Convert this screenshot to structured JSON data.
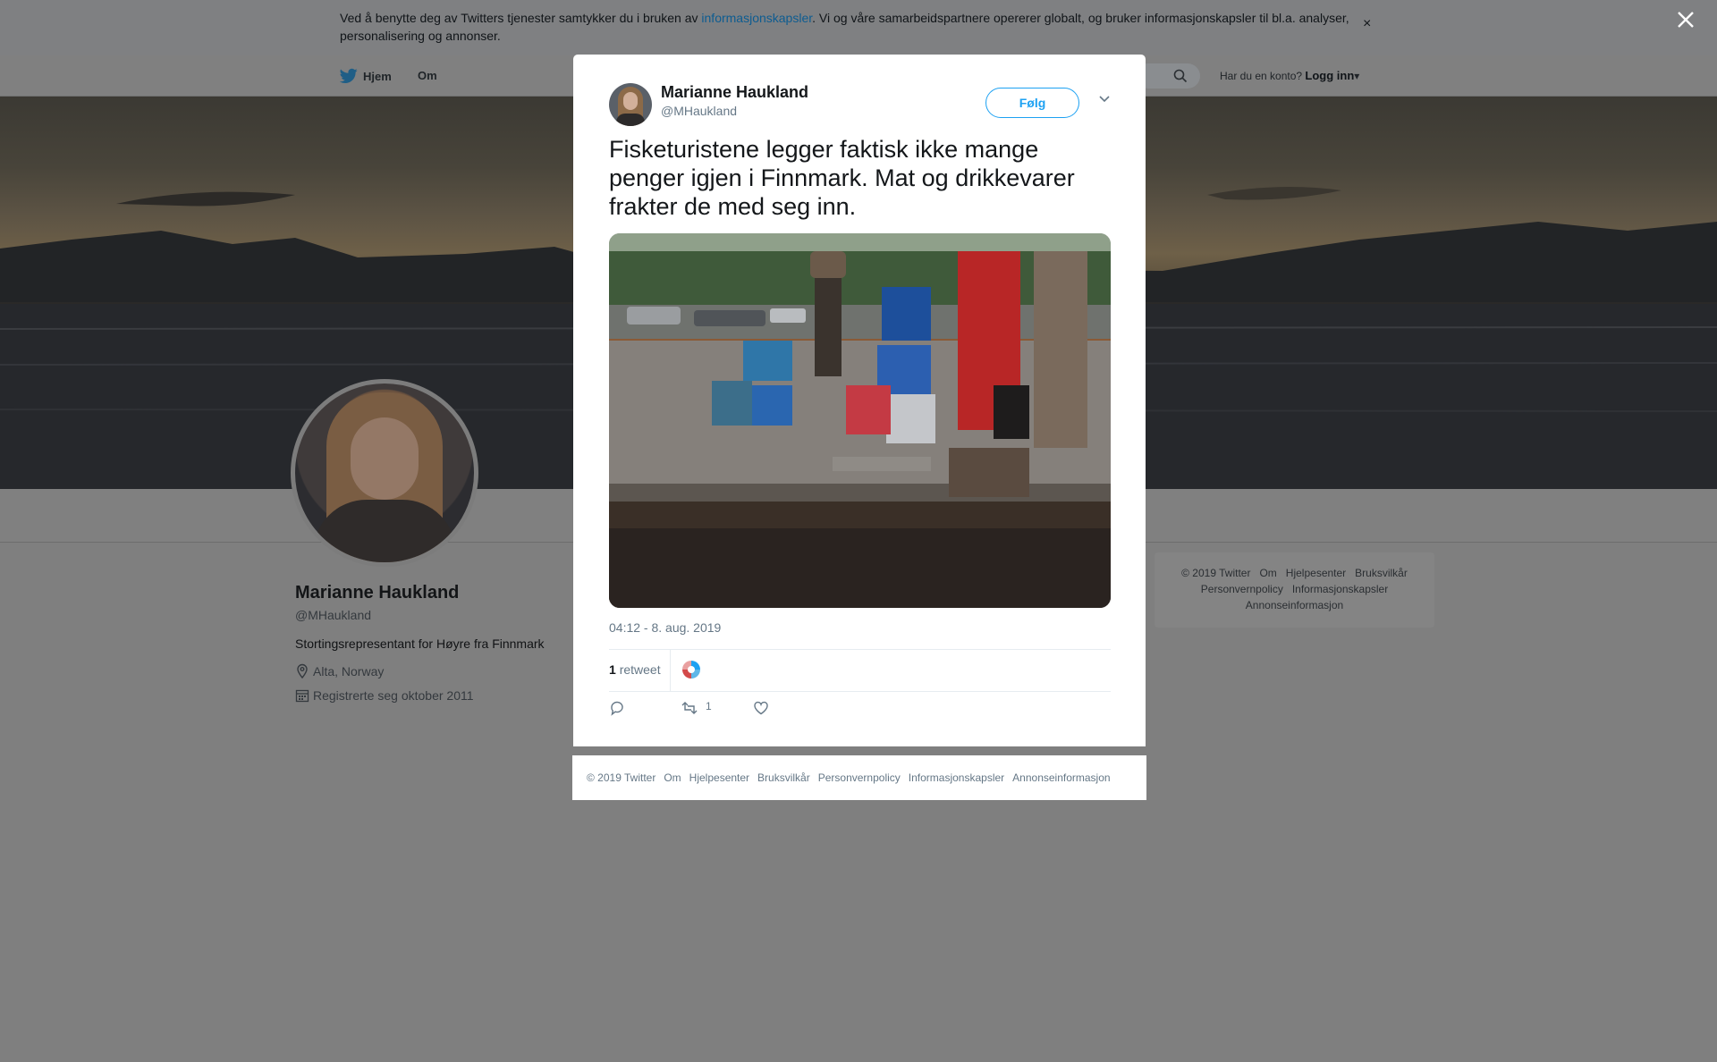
{
  "cookie_bar": {
    "text_before": "Ved å benytte deg av Twitters tjenester samtykker du i bruken av ",
    "link": "informasjonskapsler",
    "text_after": ". Vi og våre samarbeidspartnere opererer globalt, og bruker informasjonskapsler til bl.a. analyser, personalisering og annonser.",
    "close": "×"
  },
  "nav": {
    "home": "Hjem",
    "about": "Om",
    "account_prompt": "Har du en konto?",
    "login": "Logg inn",
    "login_caret": "▾"
  },
  "profile": {
    "name": "Marianne Haukland",
    "handle": "@MHaukland",
    "bio": "Stortingsrepresentant for Høyre fra Finnmark",
    "location": "Alta, Norway",
    "joined": "Registrerte seg oktober 2011"
  },
  "side_footer": [
    "© 2019 Twitter",
    "Om",
    "Hjelpesenter",
    "Bruksvilkår",
    "Personvernpolicy",
    "Informasjonskapsler",
    "Annonseinformasjon"
  ],
  "tweet": {
    "author_name": "Marianne Haukland",
    "author_handle": "@MHaukland",
    "follow_label": "Følg",
    "text": "Fisketuristene legger faktisk ikke mange penger igjen i Finnmark. Mat og drikkevarer frakter de med seg inn.",
    "timestamp": "04:12 - 8. aug. 2019",
    "retweet_count": "1",
    "retweet_word": "retweet",
    "action_retweet_count": "1"
  },
  "modal_footer": [
    "© 2019 Twitter",
    "Om",
    "Hjelpesenter",
    "Bruksvilkår",
    "Personvernpolicy",
    "Informasjonskapsler",
    "Annonseinformasjon"
  ],
  "colors": {
    "accent": "#1da1f2",
    "secondary_text": "#657786",
    "overlay": "#7f7f7f"
  },
  "icons": {
    "twitter_bird": "bird-icon",
    "search": "search-icon",
    "close": "close-icon",
    "location": "location-pin-icon",
    "calendar": "calendar-icon",
    "reply": "reply-icon",
    "retweet": "retweet-icon",
    "like": "heart-icon",
    "chevron": "chevron-down-icon"
  }
}
